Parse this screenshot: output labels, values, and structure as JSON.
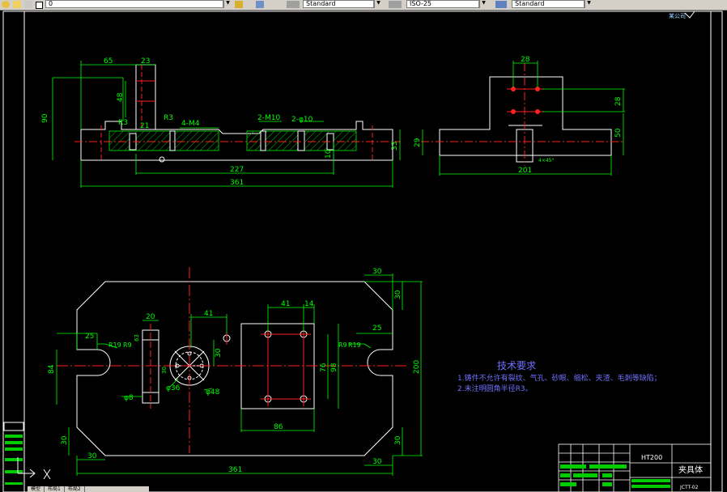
{
  "toolbar": {
    "layer_value": "0",
    "text_style": "Standard",
    "dim_style": "ISO-25",
    "table_style": "Standard"
  },
  "top_right_label": "某公司",
  "top_view": {
    "dims": {
      "d65": "65",
      "d23": "23",
      "d48": "48",
      "d90": "90",
      "d21": "21",
      "r3a": "R3",
      "r3b": "R3",
      "m4": "4-M4",
      "m10": "2-M10",
      "phi10": "2-φ10",
      "d33": "33",
      "d10": "10",
      "d227": "227",
      "d361": "361"
    }
  },
  "side_view": {
    "dims": {
      "d28a": "28",
      "d28b": "28",
      "d50": "50",
      "d29": "29",
      "d201": "201",
      "d4": "4×45°"
    }
  },
  "plan_view": {
    "dims": {
      "d30_tr": "30",
      "d30_r": "30",
      "d200": "200",
      "d41": "41",
      "d14": "14",
      "d41b": "41",
      "d20": "20",
      "d25l": "25",
      "d25r": "25",
      "r19l": "R19",
      "r9l": "R9",
      "r9r": "R9",
      "r19r": "R19",
      "d84": "84",
      "d30m": "30",
      "phi36": "φ36",
      "phi48": "φ48",
      "phi8": "φ8",
      "d98": "98",
      "d76": "76",
      "d86": "86",
      "d30_bl": "30",
      "d30_br": "30",
      "d30_b": "30",
      "d30_bb": "30",
      "d361b": "361",
      "d63": "63",
      "d30_v": "30"
    }
  },
  "notes": {
    "title": "技术要求",
    "line1": "1.铸件不允许有裂纹、气孔、砂眼、缩松、夹渣、毛刺等缺陷；",
    "line2": "2.未注明圆角半径R3。"
  },
  "title_block": {
    "material": "HT200",
    "part_name": "夹具体",
    "drawing_no": "JCTT-02"
  },
  "bottom_tabs": [
    "模型",
    "布局1",
    "布局2"
  ],
  "colors": {
    "outline": "#ffffff",
    "dim": "#00ff00",
    "center": "#ff2020",
    "hatch": "#00ff00",
    "note": "#6060ff"
  }
}
